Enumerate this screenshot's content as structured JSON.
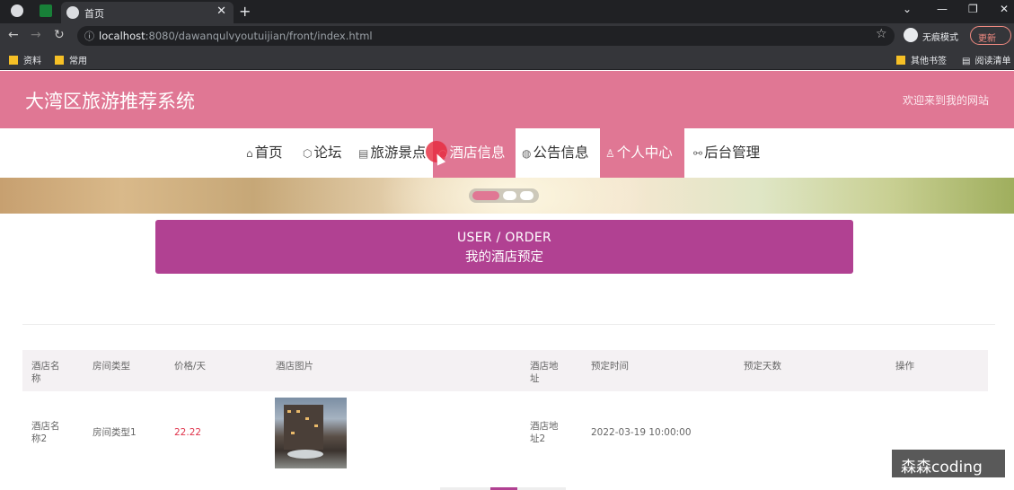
{
  "browser": {
    "tab_title": "首页",
    "url_host": "localhost",
    "url_rest": ":8080/dawanqulvyoutuijian/front/index.html",
    "incognito_label": "无痕模式",
    "update_label": "更新",
    "bookmarks": [
      "资料",
      "常用"
    ],
    "bookmarks_right": [
      "其他书签",
      "阅读清单"
    ]
  },
  "site": {
    "title": "大湾区旅游推荐系统",
    "welcome": "欢迎来到我的网站"
  },
  "menu": [
    {
      "icon": "⌂",
      "label": "首页"
    },
    {
      "icon": "⬡",
      "label": "论坛"
    },
    {
      "icon": "▤",
      "label": "旅游景点"
    },
    {
      "icon": "○",
      "label": "酒店信息"
    },
    {
      "icon": "◍",
      "label": "公告信息"
    },
    {
      "icon": "♙",
      "label": "个人中心"
    },
    {
      "icon": "⚯",
      "label": "后台管理"
    }
  ],
  "page_title": {
    "en": "USER / ORDER",
    "zh": "我的酒店预定"
  },
  "table": {
    "headers": [
      "酒店名称",
      "房间类型",
      "价格/天",
      "酒店图片",
      "酒店地址",
      "预定时间",
      "预定天数",
      "操作"
    ],
    "rows": [
      {
        "hotel_name": "酒店名称2",
        "room_type": "房间类型1",
        "price": "22.22",
        "address": "酒店地址2",
        "booking_time": "2022-03-19 10:00:00",
        "days": "",
        "action": ""
      }
    ]
  },
  "watermark": "森森coding",
  "colors": {
    "header_pink": "#e07794",
    "title_purple": "#b14192",
    "price_red": "#e0344c"
  }
}
